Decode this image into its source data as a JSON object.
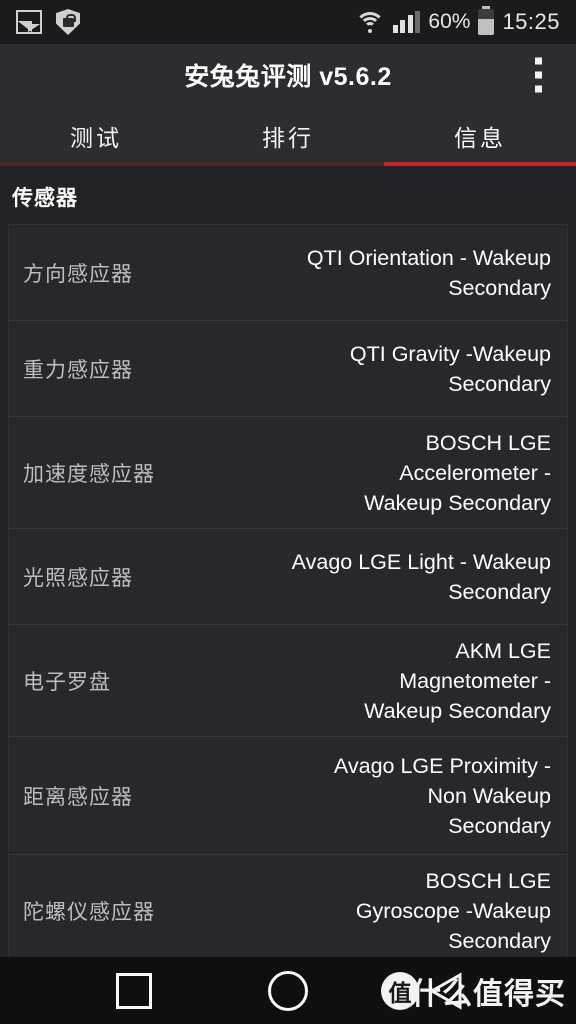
{
  "statusbar": {
    "icons_left": [
      "image-icon",
      "shield-lock-icon"
    ],
    "icons_right": [
      "wifi-icon",
      "signal-icon",
      "battery-icon"
    ],
    "battery_percent": "60%",
    "time": "15:25"
  },
  "appbar": {
    "title": "安兔兔评测 v5.6.2",
    "overflow": "overflow-menu-icon"
  },
  "tabs": [
    {
      "label": "测试",
      "active": false
    },
    {
      "label": "排行",
      "active": false
    },
    {
      "label": "信息",
      "active": true
    }
  ],
  "section": {
    "title": "传感器"
  },
  "sensors": [
    {
      "label": "方向感应器",
      "value": "QTI Orientation - Wakeup Secondary"
    },
    {
      "label": "重力感应器",
      "value": "QTI Gravity -Wakeup Secondary"
    },
    {
      "label": "加速度感应器",
      "value": "BOSCH LGE Accelerometer - Wakeup Secondary"
    },
    {
      "label": "光照感应器",
      "value": "Avago LGE Light - Wakeup Secondary"
    },
    {
      "label": "电子罗盘",
      "value": "AKM LGE Magnetometer - Wakeup Secondary"
    },
    {
      "label": "距离感应器",
      "value": "Avago LGE Proximity - Non Wakeup Secondary"
    },
    {
      "label": "陀螺仪感应器",
      "value": "BOSCH LGE Gyroscope -Wakeup Secondary"
    }
  ],
  "navbar": {
    "recents": "recents-square-icon",
    "home": "home-circle-icon",
    "back": "back-triangle-icon"
  },
  "watermark": {
    "badge": "值",
    "text": "什么值得买"
  },
  "colors": {
    "accent_red": "#c8232c",
    "accent_red_dim": "#5d2025",
    "appbar_bg": "#2b2d30",
    "page_bg": "#212326",
    "row_bg": "#26282b",
    "navbar_bg": "#0e0f11"
  }
}
